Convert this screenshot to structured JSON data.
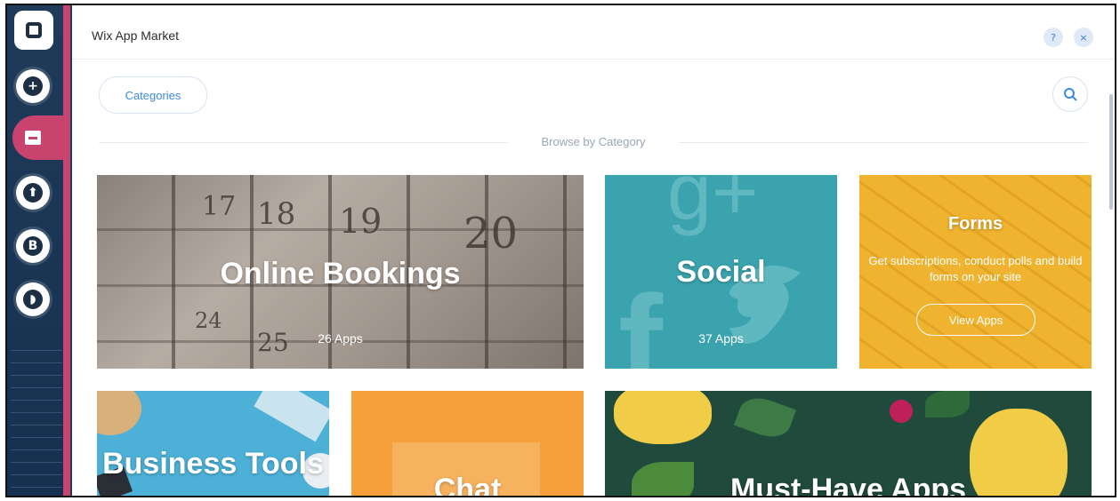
{
  "app": {
    "title": "Wix App Market",
    "help_icon": "?",
    "close_icon": "×"
  },
  "toolbar": {
    "categories_label": "Categories",
    "browse_label": "Browse by Category"
  },
  "sidebar": {
    "items": [
      {
        "icon": "pages-icon"
      },
      {
        "icon": "add-icon",
        "glyph": "+"
      },
      {
        "icon": "app-market-icon"
      },
      {
        "icon": "upload-icon",
        "glyph": "⬆"
      },
      {
        "icon": "blog-icon",
        "glyph": "B"
      },
      {
        "icon": "chat-icon",
        "glyph": "◗"
      }
    ]
  },
  "categories": [
    {
      "name": "Online Bookings",
      "count": "26 Apps",
      "color": "#a49a91"
    },
    {
      "name": "Social",
      "count": "37 Apps",
      "color": "#3aa3ad"
    },
    {
      "name": "Forms",
      "description": "Get subscriptions, conduct polls and build forms on your site",
      "button": "View Apps",
      "color": "#efb32f"
    },
    {
      "name": "Business Tools",
      "color": "#4db0d6"
    },
    {
      "name": "Chat",
      "color": "#f5a03a"
    },
    {
      "name": "Must-Have Apps",
      "color": "#1f4a3c"
    }
  ],
  "calendar_numbers": [
    "17",
    "18",
    "19",
    "20",
    "24",
    "25"
  ]
}
